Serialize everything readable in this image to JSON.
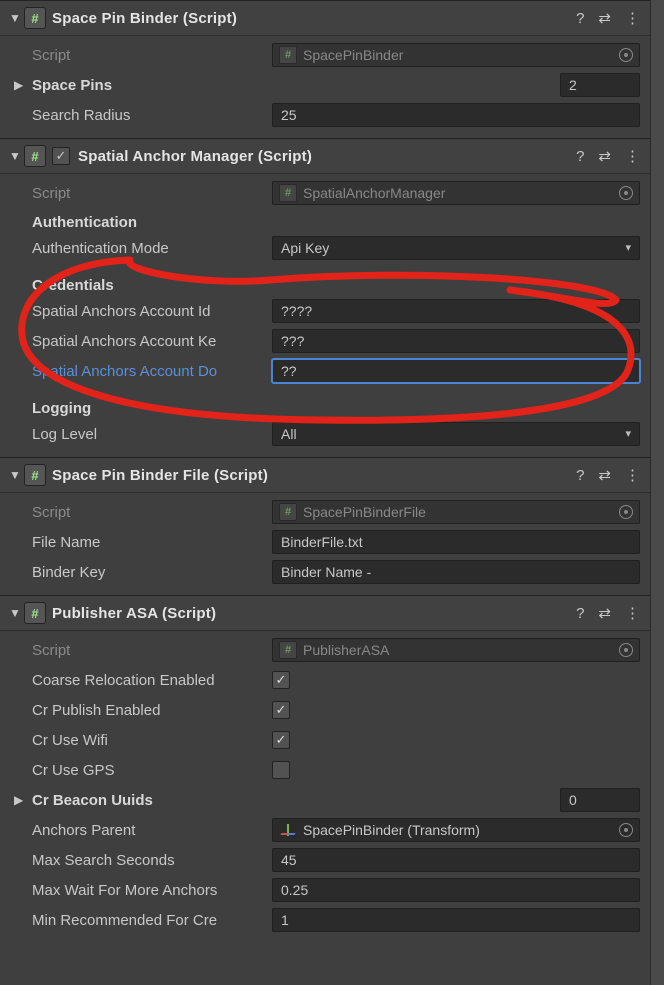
{
  "components": {
    "spacePinBinder": {
      "headerTitle": "Space Pin Binder (Script)",
      "scriptLabel": "Script",
      "scriptValue": "SpacePinBinder",
      "spacePinsLabel": "Space Pins",
      "spacePinsCount": "2",
      "searchRadiusLabel": "Search Radius",
      "searchRadiusValue": "25"
    },
    "spatialAnchorManager": {
      "headerTitle": "Spatial Anchor Manager (Script)",
      "scriptLabel": "Script",
      "scriptValue": "SpatialAnchorManager",
      "authHeader": "Authentication",
      "authModeLabel": "Authentication Mode",
      "authModeValue": "Api Key",
      "credHeader": "Credentials",
      "accountIdLabel": "Spatial Anchors Account Id",
      "accountIdValue": "????",
      "accountKeyLabel": "Spatial Anchors Account Ke",
      "accountKeyValue": "???",
      "accountDomainLabel": "Spatial Anchors Account Do",
      "accountDomainValue": "??",
      "loggingHeader": "Logging",
      "logLevelLabel": "Log Level",
      "logLevelValue": "All"
    },
    "spacePinBinderFile": {
      "headerTitle": "Space Pin Binder File (Script)",
      "scriptLabel": "Script",
      "scriptValue": "SpacePinBinderFile",
      "fileNameLabel": "File Name",
      "fileNameValue": "BinderFile.txt",
      "binderKeyLabel": "Binder Key",
      "binderKeyValue": "Binder Name -"
    },
    "publisherASA": {
      "headerTitle": "Publisher ASA (Script)",
      "scriptLabel": "Script",
      "scriptValue": "PublisherASA",
      "coarseRelocLabel": "Coarse Relocation Enabled",
      "coarseRelocChecked": true,
      "crPublishLabel": "Cr Publish Enabled",
      "crPublishChecked": true,
      "crUseWifiLabel": "Cr Use Wifi",
      "crUseWifiChecked": true,
      "crUseGpsLabel": "Cr Use GPS",
      "crUseGpsChecked": false,
      "crBeaconLabel": "Cr Beacon Uuids",
      "crBeaconCount": "0",
      "anchorsParentLabel": "Anchors Parent",
      "anchorsParentValue": "SpacePinBinder (Transform)",
      "maxSearchSecLabel": "Max Search Seconds",
      "maxSearchSecValue": "45",
      "maxWaitLabel": "Max Wait For More Anchors",
      "maxWaitValue": "0.25",
      "minRecLabel": "Min Recommended For Cre",
      "minRecValue": "1"
    }
  },
  "icons": {
    "help": "?",
    "preset": "⇄",
    "menu": "⋮",
    "foldDown": "▼",
    "foldRight": "▶",
    "check": "✓",
    "hash": "#",
    "ddCaret": "▾"
  }
}
